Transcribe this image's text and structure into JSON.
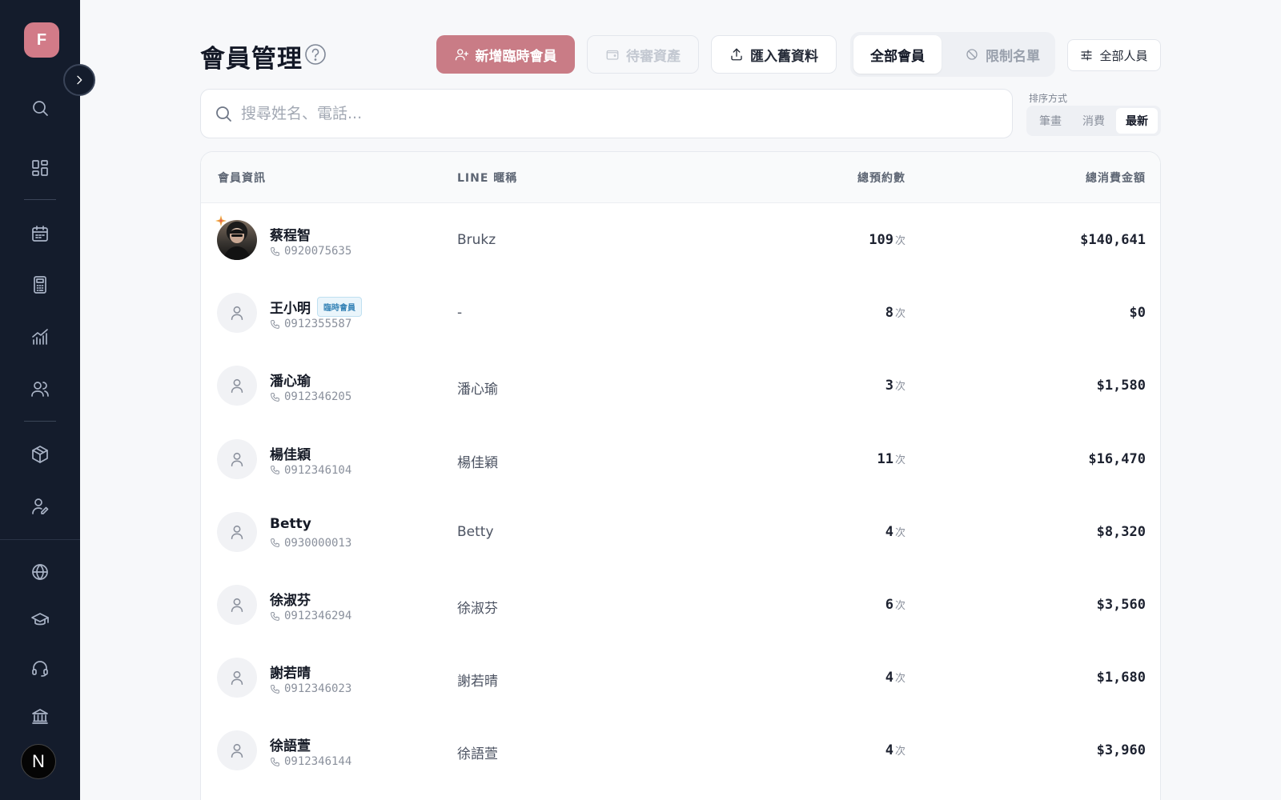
{
  "sidebar": {
    "logo_letter": "F",
    "user_initial": "N",
    "icons": [
      "search-icon",
      "dashboard-icon",
      "calendar-icon",
      "calculator-icon",
      "analytics-icon",
      "users-icon",
      "package-icon",
      "staff-edit-icon",
      "globe-icon",
      "graduation-cap-icon",
      "headset-icon",
      "bank-icon"
    ]
  },
  "header": {
    "title": "會員管理",
    "add_temp_member": "新增臨時會員",
    "pending_assets": "待審資產",
    "import_old_data": "匯入舊資料",
    "all_members": "全部會員",
    "blacklist": "限制名單",
    "all_staff": "全部人員"
  },
  "search": {
    "placeholder": "搜尋姓名、電話..."
  },
  "sort": {
    "label": "排序方式",
    "options": [
      "筆畫",
      "消費",
      "最新"
    ],
    "selected": "最新"
  },
  "table": {
    "columns": [
      "會員資訊",
      "LINE 暱稱",
      "總預約數",
      "總消費金額"
    ],
    "count_unit": "次",
    "rows": [
      {
        "name": "蔡程智",
        "phone": "0920075635",
        "line": "Brukz",
        "count": "109",
        "amount": "$140,641",
        "badge": "",
        "photo": true
      },
      {
        "name": "王小明",
        "phone": "0912355587",
        "line": "-",
        "count": "8",
        "amount": "$0",
        "badge": "臨時會員",
        "photo": false
      },
      {
        "name": "潘心瑜",
        "phone": "0912346205",
        "line": "潘心瑜",
        "count": "3",
        "amount": "$1,580",
        "badge": "",
        "photo": false
      },
      {
        "name": "楊佳穎",
        "phone": "0912346104",
        "line": "楊佳穎",
        "count": "11",
        "amount": "$16,470",
        "badge": "",
        "photo": false
      },
      {
        "name": "Betty",
        "phone": "0930000013",
        "line": "Betty",
        "count": "4",
        "amount": "$8,320",
        "badge": "",
        "photo": false
      },
      {
        "name": "徐淑芬",
        "phone": "0912346294",
        "line": "徐淑芬",
        "count": "6",
        "amount": "$3,560",
        "badge": "",
        "photo": false
      },
      {
        "name": "謝若晴",
        "phone": "0912346023",
        "line": "謝若晴",
        "count": "4",
        "amount": "$1,680",
        "badge": "",
        "photo": false
      },
      {
        "name": "徐語萱",
        "phone": "0912346144",
        "line": "徐語萱",
        "count": "4",
        "amount": "$3,960",
        "badge": "",
        "photo": false
      }
    ]
  },
  "colors": {
    "sidebar_bg": "#141c2c",
    "primary": "#c97c86",
    "logo_bg": "#d27b88",
    "badge_text": "#3a86b8"
  }
}
